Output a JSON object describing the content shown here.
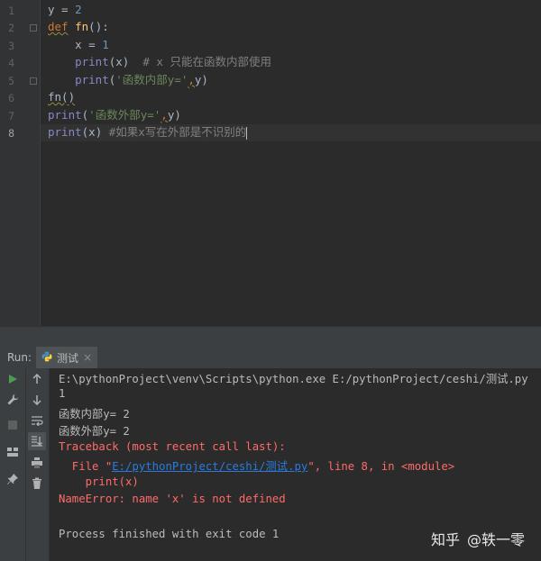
{
  "editor": {
    "line_numbers": [
      "1",
      "2",
      "3",
      "4",
      "5",
      "6",
      "7",
      "8"
    ],
    "lines": {
      "l1": {
        "a": "y = ",
        "b": "2"
      },
      "l2": {
        "kw": "def",
        "sp": " ",
        "fn": "fn",
        "rest": "():"
      },
      "l3": {
        "a": "    x = ",
        "b": "1"
      },
      "l4": {
        "bi": "    print",
        "a": "(x)  ",
        "cmt": "# x 只能在函数内部使用"
      },
      "l5": {
        "bi": "    print",
        "a": "(",
        "str": "'函数内部y='",
        "comma": ",",
        "b": "y)"
      },
      "l6": {
        "a": "fn()"
      },
      "l7": {
        "bi": "print",
        "a": "(",
        "str": "'函数外部y='",
        "comma": ",",
        "b": "y)"
      },
      "l8": {
        "bi": "print",
        "a": "(x) ",
        "cmt": "#如果x写在外部是不识别的"
      }
    }
  },
  "run": {
    "label": "Run:",
    "tab_name": "测试",
    "tab_close": "×"
  },
  "console": {
    "cmd": "E:\\pythonProject\\venv\\Scripts\\python.exe E:/pythonProject/ceshi/测试.py",
    "out1": "1",
    "out2": "函数内部y= 2",
    "out3": "函数外部y= 2",
    "tb1": "Traceback (most recent call last):",
    "tb2_pre": "  File \"",
    "tb2_link": "E:/pythonProject/ceshi/测试.py",
    "tb2_post": "\", line 8, in <module>",
    "tb3": "    print(x)",
    "tb4": "NameError: name 'x' is not defined",
    "finish": "Process finished with exit code 1"
  },
  "watermark": {
    "site": "知乎",
    "author": "@轶一零"
  },
  "colors": {
    "background": "#2b2b2b",
    "keyword": "#cc7832",
    "error": "#ff6b68",
    "link": "#287bde"
  }
}
